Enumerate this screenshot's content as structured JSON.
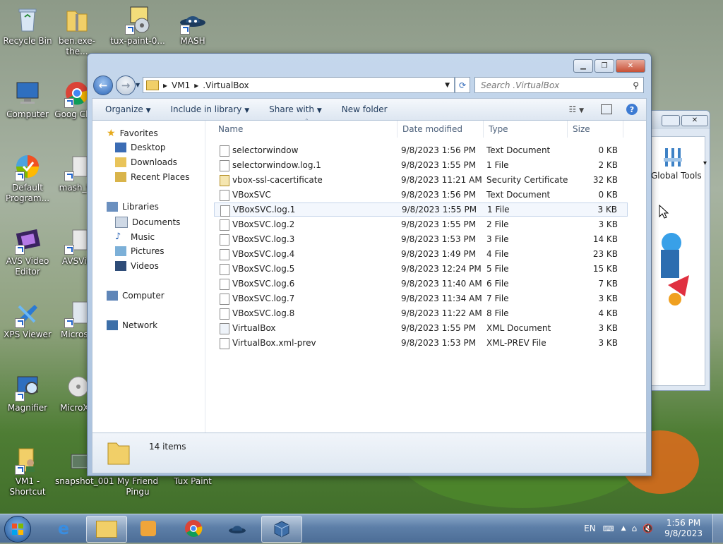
{
  "desktop": {
    "icons": [
      {
        "label": "Recycle Bin"
      },
      {
        "label": "ben.exe-the..."
      },
      {
        "label": "tux-paint-0..."
      },
      {
        "label": "MASH"
      },
      {
        "label": "Computer"
      },
      {
        "label": "Goog Chro"
      },
      {
        "label": "Default Program..."
      },
      {
        "label": "mash_fu"
      },
      {
        "label": "AVS Video Editor"
      },
      {
        "label": "AVSVid"
      },
      {
        "label": "XPS Viewer"
      },
      {
        "label": "Microso"
      },
      {
        "label": "Magnifier"
      },
      {
        "label": "MicroXP"
      },
      {
        "label": "VM1 - Shortcut"
      },
      {
        "label": "snapshot_001"
      },
      {
        "label": "My Friend Pingu"
      },
      {
        "label": "Tux Paint"
      }
    ],
    "bg_window": {
      "label": "Global Tools"
    }
  },
  "explorer": {
    "caption": {
      "minimize": "▭",
      "maximize": "❐",
      "close": "✕"
    },
    "breadcrumb": [
      "VM1",
      ".VirtualBox"
    ],
    "search_placeholder": "Search .VirtualBox",
    "toolbar": {
      "organize": "Organize",
      "include_library": "Include in library",
      "share_with": "Share with",
      "new_folder": "New folder"
    },
    "nav": {
      "favorites": "Favorites",
      "desktop": "Desktop",
      "downloads": "Downloads",
      "recent": "Recent Places",
      "libraries": "Libraries",
      "documents": "Documents",
      "music": "Music",
      "pictures": "Pictures",
      "videos": "Videos",
      "computer": "Computer",
      "network": "Network"
    },
    "columns": {
      "name": "Name",
      "date": "Date modified",
      "type": "Type",
      "size": "Size"
    },
    "files": [
      {
        "name": "selectorwindow",
        "date": "9/8/2023 1:56 PM",
        "type": "Text Document",
        "size": "0 KB"
      },
      {
        "name": "selectorwindow.log.1",
        "date": "9/8/2023 1:55 PM",
        "type": "1 File",
        "size": "2 KB"
      },
      {
        "name": "vbox-ssl-cacertificate",
        "date": "9/8/2023 11:21 AM",
        "type": "Security Certificate",
        "size": "32 KB"
      },
      {
        "name": "VBoxSVC",
        "date": "9/8/2023 1:56 PM",
        "type": "Text Document",
        "size": "0 KB"
      },
      {
        "name": "VBoxSVC.log.1",
        "date": "9/8/2023 1:55 PM",
        "type": "1 File",
        "size": "3 KB"
      },
      {
        "name": "VBoxSVC.log.2",
        "date": "9/8/2023 1:55 PM",
        "type": "2 File",
        "size": "3 KB"
      },
      {
        "name": "VBoxSVC.log.3",
        "date": "9/8/2023 1:53 PM",
        "type": "3 File",
        "size": "14 KB"
      },
      {
        "name": "VBoxSVC.log.4",
        "date": "9/8/2023 1:49 PM",
        "type": "4 File",
        "size": "23 KB"
      },
      {
        "name": "VBoxSVC.log.5",
        "date": "9/8/2023 12:24 PM",
        "type": "5 File",
        "size": "15 KB"
      },
      {
        "name": "VBoxSVC.log.6",
        "date": "9/8/2023 11:40 AM",
        "type": "6 File",
        "size": "7 KB"
      },
      {
        "name": "VBoxSVC.log.7",
        "date": "9/8/2023 11:34 AM",
        "type": "7 File",
        "size": "3 KB"
      },
      {
        "name": "VBoxSVC.log.8",
        "date": "9/8/2023 11:22 AM",
        "type": "8 File",
        "size": "4 KB"
      },
      {
        "name": "VirtualBox",
        "date": "9/8/2023 1:55 PM",
        "type": "XML Document",
        "size": "3 KB"
      },
      {
        "name": "VirtualBox.xml-prev",
        "date": "9/8/2023 1:53 PM",
        "type": "XML-PREV File",
        "size": "3 KB"
      }
    ],
    "status": {
      "count": "14 items"
    }
  },
  "taskbar": {
    "language": "EN",
    "time": "1:56 PM",
    "date": "9/8/2023"
  }
}
